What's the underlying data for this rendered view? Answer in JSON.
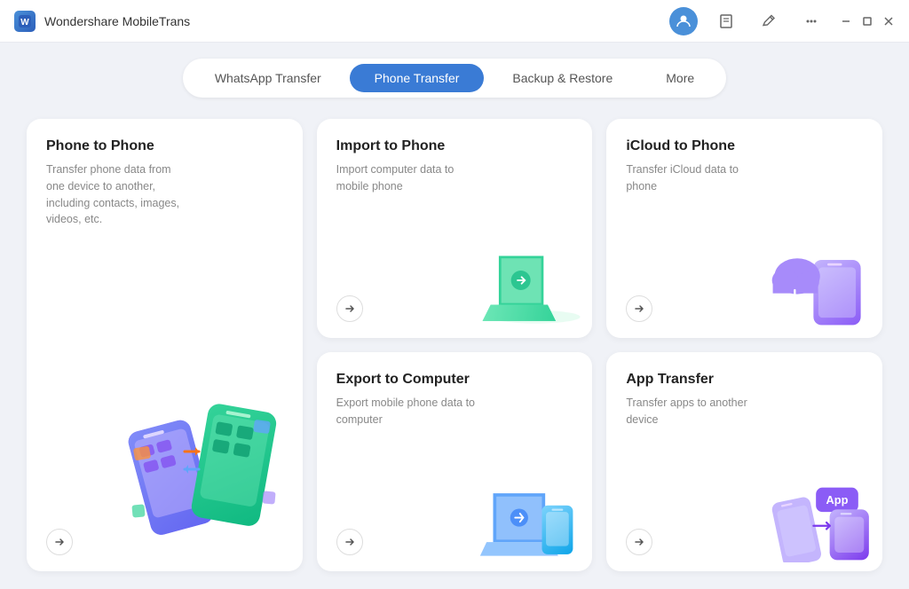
{
  "app": {
    "title": "Wondershare MobileTrans",
    "icon_letter": "W"
  },
  "nav": {
    "tabs": [
      {
        "id": "whatsapp",
        "label": "WhatsApp Transfer",
        "active": false
      },
      {
        "id": "phone",
        "label": "Phone Transfer",
        "active": true
      },
      {
        "id": "backup",
        "label": "Backup & Restore",
        "active": false
      },
      {
        "id": "more",
        "label": "More",
        "active": false
      }
    ]
  },
  "cards": [
    {
      "id": "phone-to-phone",
      "title": "Phone to Phone",
      "desc": "Transfer phone data from one device to another, including contacts, images, videos, etc.",
      "size": "large"
    },
    {
      "id": "import-to-phone",
      "title": "Import to Phone",
      "desc": "Import computer data to mobile phone",
      "size": "normal"
    },
    {
      "id": "icloud-to-phone",
      "title": "iCloud to Phone",
      "desc": "Transfer iCloud data to phone",
      "size": "normal"
    },
    {
      "id": "export-to-computer",
      "title": "Export to Computer",
      "desc": "Export mobile phone data to computer",
      "size": "normal"
    },
    {
      "id": "app-transfer",
      "title": "App Transfer",
      "desc": "Transfer apps to another device",
      "size": "normal"
    }
  ],
  "icons": {
    "arrow_right": "→",
    "minimize": "−",
    "restore": "❐",
    "close": "✕",
    "edit": "✎",
    "menu": "≡",
    "bookmark": "⧉"
  },
  "colors": {
    "active_tab_bg": "#3a7bd5",
    "active_tab_text": "#ffffff",
    "card_bg": "#ffffff",
    "body_bg": "#f0f2f7"
  }
}
